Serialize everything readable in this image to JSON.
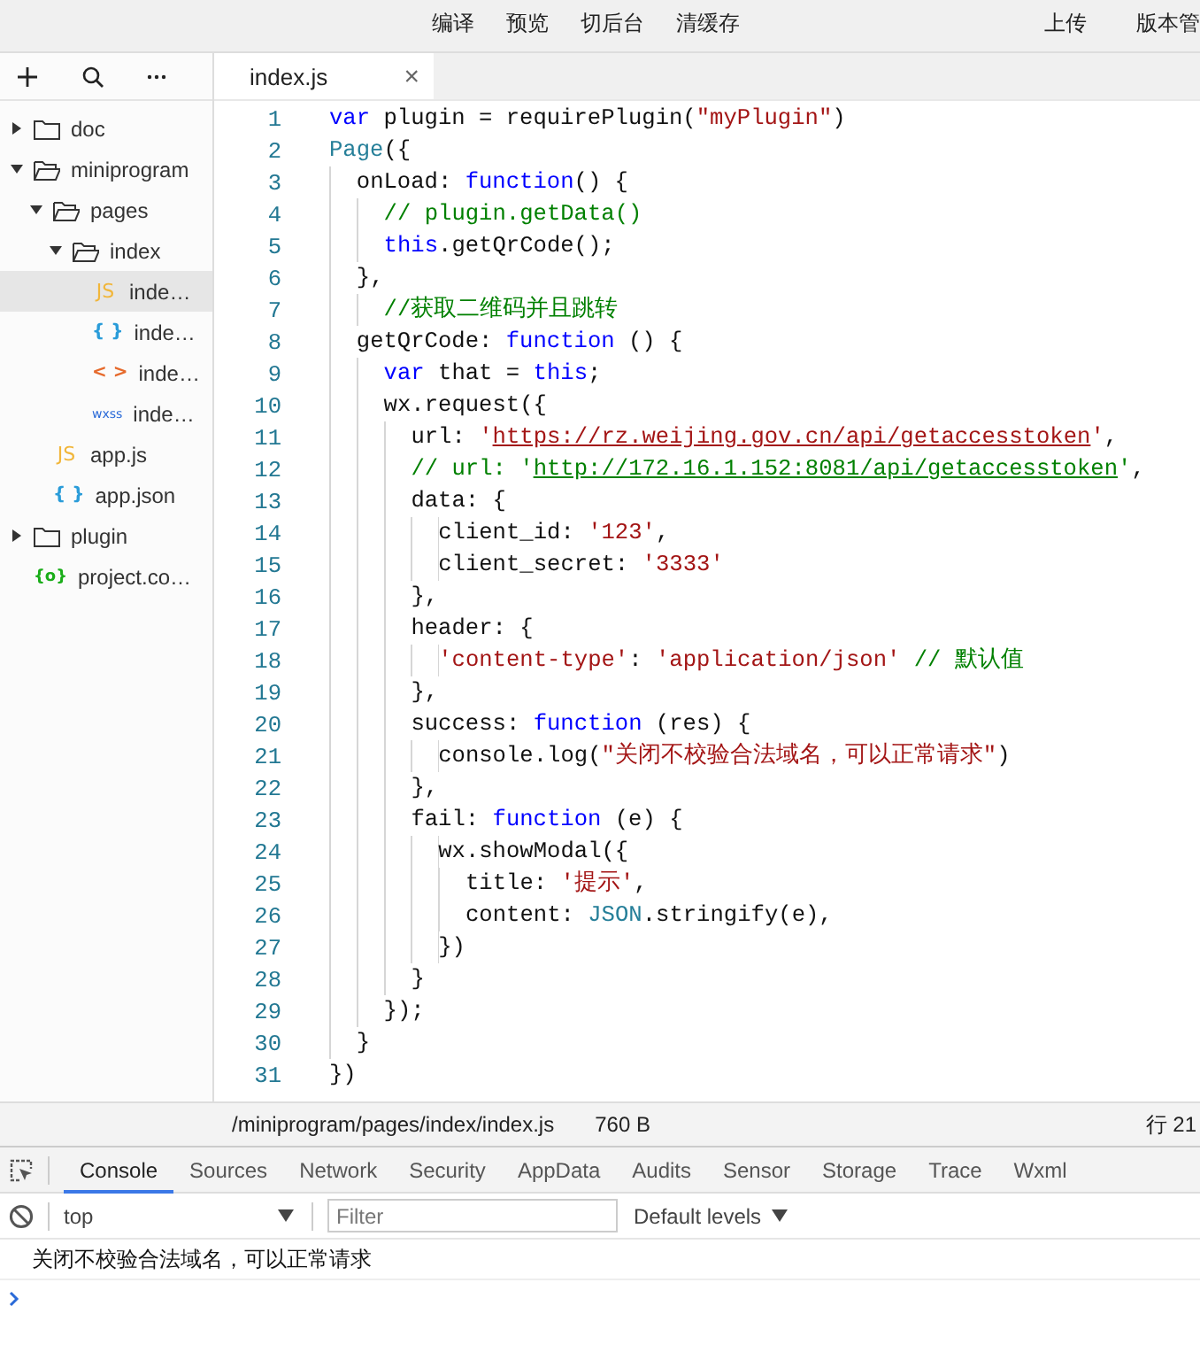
{
  "toolbar": {
    "left_buttons": [
      "编译",
      "预览",
      "切后台",
      "清缓存"
    ],
    "right_buttons": [
      "上传",
      "版本管"
    ]
  },
  "sidebar": {
    "tree": [
      {
        "kind": "folder",
        "label": "doc",
        "expanded": false,
        "selected": false
      },
      {
        "kind": "folder",
        "label": "miniprogram",
        "expanded": true,
        "selected": false,
        "children": [
          {
            "kind": "folder",
            "label": "pages",
            "expanded": true,
            "selected": false,
            "children": [
              {
                "kind": "folder",
                "label": "index",
                "expanded": true,
                "selected": false,
                "children": [
                  {
                    "kind": "js",
                    "badge": "JS",
                    "label": "inde…",
                    "selected": true
                  },
                  {
                    "kind": "json",
                    "badge": "{ }",
                    "label": "inde…",
                    "selected": false
                  },
                  {
                    "kind": "wxml",
                    "badge": "< >",
                    "label": "inde…",
                    "selected": false
                  },
                  {
                    "kind": "wxss",
                    "badge": "wxss",
                    "label": "inde…",
                    "selected": false
                  }
                ]
              }
            ]
          },
          {
            "kind": "js",
            "badge": "JS",
            "label": "app.js",
            "selected": false
          },
          {
            "kind": "json",
            "badge": "{ }",
            "label": "app.json",
            "selected": false
          }
        ]
      },
      {
        "kind": "folder",
        "label": "plugin",
        "expanded": false,
        "selected": false
      },
      {
        "kind": "config",
        "badge": "{o}",
        "label": "project.co…",
        "selected": false
      }
    ]
  },
  "editor": {
    "tabs": [
      {
        "label": "index.js",
        "close": "×",
        "selected": true
      }
    ],
    "lines": [
      {
        "n": "1",
        "tokens": [
          {
            "kind": "kw",
            "text": "var"
          },
          {
            "kind": "p",
            "text": " plugin = requirePlugin("
          },
          {
            "kind": "s",
            "text": "\"myPlugin\""
          },
          {
            "kind": "p",
            "text": ")"
          }
        ]
      },
      {
        "n": "2",
        "tokens": [
          {
            "kind": "t",
            "text": "Page"
          },
          {
            "kind": "p",
            "text": "({"
          }
        ]
      },
      {
        "n": "3",
        "tokens": [
          {
            "kind": "p",
            "text": "  onLoad: "
          },
          {
            "kind": "kw",
            "text": "function"
          },
          {
            "kind": "p",
            "text": "() {"
          }
        ]
      },
      {
        "n": "4",
        "tokens": [
          {
            "kind": "c",
            "text": "    // plugin.getData()"
          }
        ]
      },
      {
        "n": "5",
        "tokens": [
          {
            "kind": "kw",
            "text": "    this"
          },
          {
            "kind": "p",
            "text": ".getQrCode();"
          }
        ]
      },
      {
        "n": "6",
        "tokens": [
          {
            "kind": "p",
            "text": "  },"
          }
        ]
      },
      {
        "n": "7",
        "tokens": [
          {
            "kind": "c",
            "text": "    //获取二维码并且跳转"
          }
        ]
      },
      {
        "n": "8",
        "tokens": [
          {
            "kind": "p",
            "text": "  getQrCode: "
          },
          {
            "kind": "kw",
            "text": "function"
          },
          {
            "kind": "p",
            "text": " () {"
          }
        ]
      },
      {
        "n": "9",
        "tokens": [
          {
            "kind": "kw",
            "text": "    var"
          },
          {
            "kind": "p",
            "text": " that = "
          },
          {
            "kind": "kw",
            "text": "this"
          },
          {
            "kind": "p",
            "text": ";"
          }
        ]
      },
      {
        "n": "10",
        "tokens": [
          {
            "kind": "p",
            "text": "    wx.request({"
          }
        ]
      },
      {
        "n": "11",
        "tokens": [
          {
            "kind": "p",
            "text": "      url: "
          },
          {
            "kind": "s",
            "text": "'"
          },
          {
            "kind": "sl",
            "text": "https://rz.weijing.gov.cn/api/getaccesstoken"
          },
          {
            "kind": "s",
            "text": "'"
          },
          {
            "kind": "p",
            "text": ","
          }
        ]
      },
      {
        "n": "12",
        "tokens": [
          {
            "kind": "c",
            "text": "      // url: '"
          },
          {
            "kind": "cl",
            "text": "http://172.16.1.152:8081/api/getaccesstoken"
          },
          {
            "kind": "c",
            "text": "'"
          },
          {
            "kind": "p",
            "text": ","
          }
        ]
      },
      {
        "n": "13",
        "tokens": [
          {
            "kind": "p",
            "text": "      data: {"
          }
        ]
      },
      {
        "n": "14",
        "tokens": [
          {
            "kind": "p",
            "text": "        client_id: "
          },
          {
            "kind": "s",
            "text": "'123'"
          },
          {
            "kind": "p",
            "text": ","
          }
        ]
      },
      {
        "n": "15",
        "tokens": [
          {
            "kind": "p",
            "text": "        client_secret: "
          },
          {
            "kind": "s",
            "text": "'3333'"
          }
        ]
      },
      {
        "n": "16",
        "tokens": [
          {
            "kind": "p",
            "text": "      },"
          }
        ]
      },
      {
        "n": "17",
        "tokens": [
          {
            "kind": "p",
            "text": "      header: {"
          }
        ]
      },
      {
        "n": "18",
        "tokens": [
          {
            "kind": "s",
            "text": "        'content-type'"
          },
          {
            "kind": "p",
            "text": ": "
          },
          {
            "kind": "s",
            "text": "'application/json'"
          },
          {
            "kind": "c",
            "text": " // 默认值"
          }
        ]
      },
      {
        "n": "19",
        "tokens": [
          {
            "kind": "p",
            "text": "      },"
          }
        ]
      },
      {
        "n": "20",
        "tokens": [
          {
            "kind": "p",
            "text": "      success: "
          },
          {
            "kind": "kw",
            "text": "function"
          },
          {
            "kind": "p",
            "text": " (res) {"
          }
        ]
      },
      {
        "n": "21",
        "tokens": [
          {
            "kind": "p",
            "text": "        console.log("
          },
          {
            "kind": "s",
            "text": "\"关闭不校验合法域名，可以正常请求\""
          },
          {
            "kind": "p",
            "text": ")"
          }
        ]
      },
      {
        "n": "22",
        "tokens": [
          {
            "kind": "p",
            "text": "      },"
          }
        ]
      },
      {
        "n": "23",
        "tokens": [
          {
            "kind": "p",
            "text": "      fail: "
          },
          {
            "kind": "kw",
            "text": "function"
          },
          {
            "kind": "p",
            "text": " (e) {"
          }
        ]
      },
      {
        "n": "24",
        "tokens": [
          {
            "kind": "p",
            "text": "        wx.showModal({"
          }
        ]
      },
      {
        "n": "25",
        "tokens": [
          {
            "kind": "p",
            "text": "          title: "
          },
          {
            "kind": "s",
            "text": "'提示'"
          },
          {
            "kind": "p",
            "text": ","
          }
        ]
      },
      {
        "n": "26",
        "tokens": [
          {
            "kind": "p",
            "text": "          content: "
          },
          {
            "kind": "t",
            "text": "JSON"
          },
          {
            "kind": "p",
            "text": ".stringify(e),"
          }
        ]
      },
      {
        "n": "27",
        "tokens": [
          {
            "kind": "p",
            "text": "        })"
          }
        ]
      },
      {
        "n": "28",
        "tokens": [
          {
            "kind": "p",
            "text": "      }"
          }
        ]
      },
      {
        "n": "29",
        "tokens": [
          {
            "kind": "p",
            "text": "    });"
          }
        ]
      },
      {
        "n": "30",
        "tokens": [
          {
            "kind": "p",
            "text": "  }"
          }
        ]
      },
      {
        "n": "31",
        "tokens": [
          {
            "kind": "p",
            "text": "})"
          }
        ]
      }
    ]
  },
  "status_bar": {
    "path": "/miniprogram/pages/index/index.js",
    "size": "760 B",
    "position": "行 21"
  },
  "devtools": {
    "tabs": [
      {
        "label": "Console",
        "selected": true
      },
      {
        "label": "Sources",
        "selected": false
      },
      {
        "label": "Network",
        "selected": false
      },
      {
        "label": "Security",
        "selected": false
      },
      {
        "label": "AppData",
        "selected": false
      },
      {
        "label": "Audits",
        "selected": false
      },
      {
        "label": "Sensor",
        "selected": false
      },
      {
        "label": "Storage",
        "selected": false
      },
      {
        "label": "Trace",
        "selected": false
      },
      {
        "label": "Wxml",
        "selected": false
      }
    ],
    "context": "top",
    "filter": {
      "placeholder": "Filter"
    },
    "levels": "Default levels",
    "messages": [
      "关闭不校验合法域名，可以正常请求"
    ]
  }
}
